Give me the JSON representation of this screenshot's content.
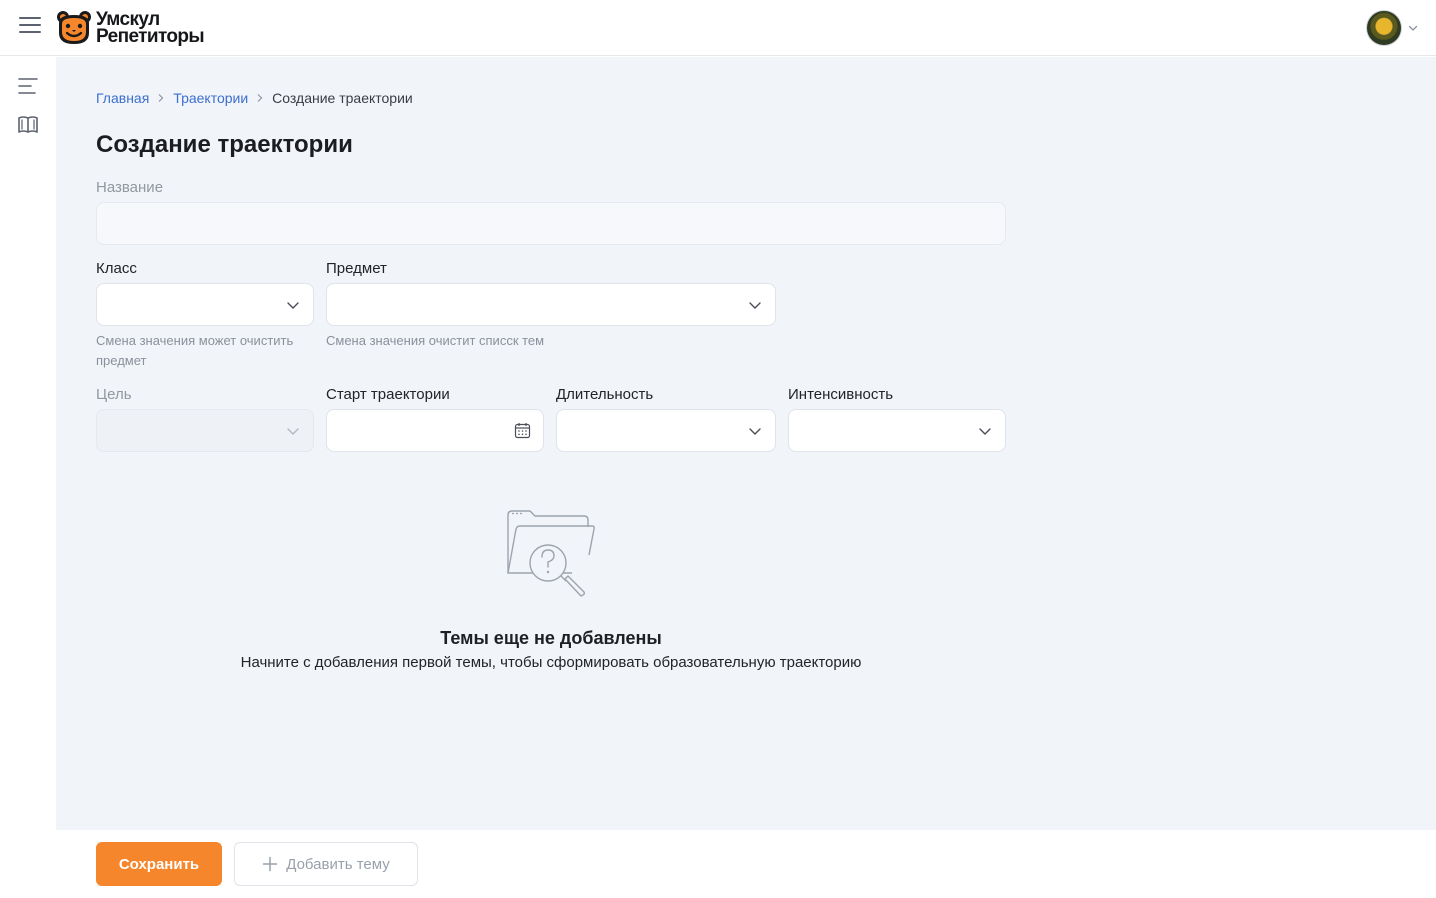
{
  "brand": {
    "line1": "Умскул",
    "line2": "Репетиторы",
    "accent": "#f6862b"
  },
  "header": {
    "menu_icon": "hamburger-icon",
    "profile_icon": "avatar"
  },
  "rail": {
    "items": [
      {
        "icon": "list-icon"
      },
      {
        "icon": "book-icon"
      }
    ]
  },
  "breadcrumb": {
    "home": "Главная",
    "section": "Траектории",
    "current": "Создание траектории"
  },
  "page": {
    "title": "Создание траектории"
  },
  "form": {
    "name": {
      "label": "Название",
      "value": ""
    },
    "grade": {
      "label": "Класс",
      "value": "",
      "hint": "Смена значения может очистить предмет"
    },
    "subject": {
      "label": "Предмет",
      "value": "",
      "hint": "Смена значения очистит списск тем"
    },
    "goal": {
      "label": "Цель",
      "value": ""
    },
    "start": {
      "label": "Старт траектории",
      "value": ""
    },
    "duration": {
      "label": "Длительность",
      "value": ""
    },
    "intensity": {
      "label": "Интенсивность",
      "value": ""
    }
  },
  "empty_state": {
    "icon": "folder-search-icon",
    "title": "Темы еще не добавлены",
    "subtitle": "Начните с добавления первой темы, чтобы сформировать образовательную траекторию"
  },
  "footer": {
    "save_label": "Сохранить",
    "add_label": "Добавить тему"
  }
}
